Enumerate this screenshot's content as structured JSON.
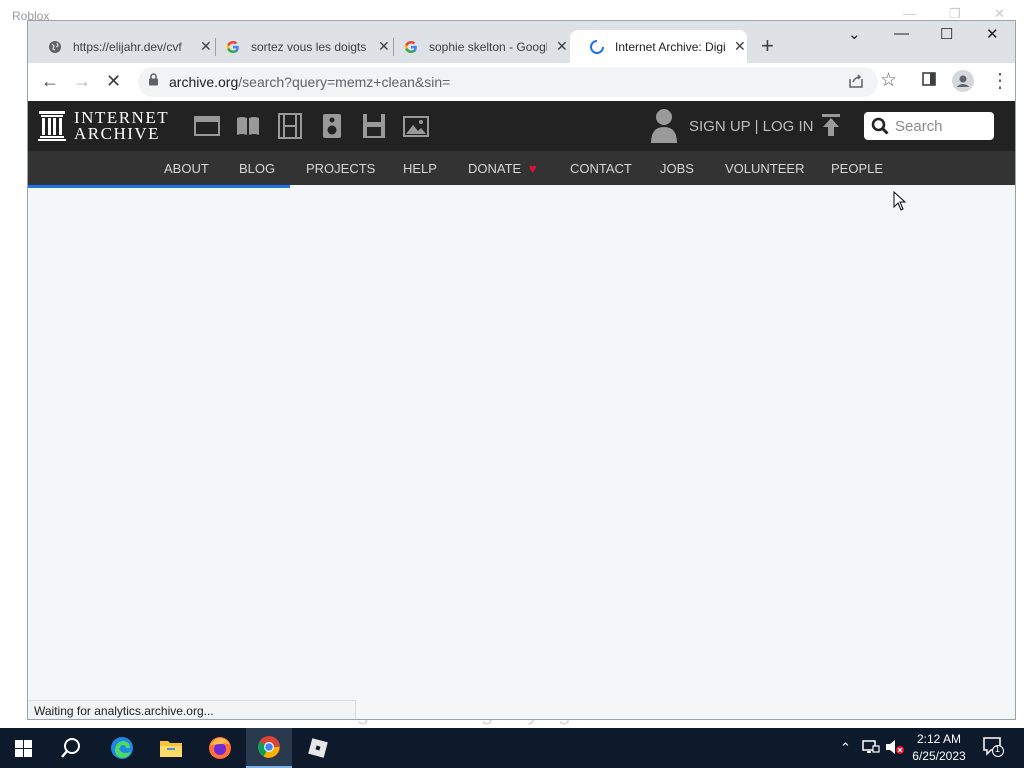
{
  "background": {
    "window_title": "Roblox",
    "message": "Something went wrong. Try again."
  },
  "tabs": [
    {
      "title": "https://elijahr.dev/cvf",
      "favicon": "globe-icon"
    },
    {
      "title": "sortez vous les doigts",
      "favicon": "google-g-icon"
    },
    {
      "title": "sophie skelton - Google",
      "favicon": "google-g-icon"
    },
    {
      "title": "Internet Archive: Digital",
      "favicon": "loading-spinner-icon"
    }
  ],
  "address_bar": {
    "domain": "archive.org",
    "path": "/search?query=memz+clean&sin="
  },
  "ia": {
    "logo_line1": "INTERNET",
    "logo_line2": "ARCHIVE",
    "signup": "SIGN UP | LOG IN",
    "search_placeholder": "Search",
    "nav": [
      "ABOUT",
      "BLOG",
      "PROJECTS",
      "HELP",
      "DONATE",
      "CONTACT",
      "JOBS",
      "VOLUNTEER",
      "PEOPLE"
    ]
  },
  "status_bar": "Waiting for analytics.archive.org...",
  "taskbar": {
    "time": "2:12 AM",
    "date": "6/25/2023",
    "notifications": "1"
  },
  "colors": {
    "ia_header": "#222222",
    "ia_nav": "#333333",
    "progress": "#1a73e8",
    "donate_heart": "#e0112b"
  }
}
